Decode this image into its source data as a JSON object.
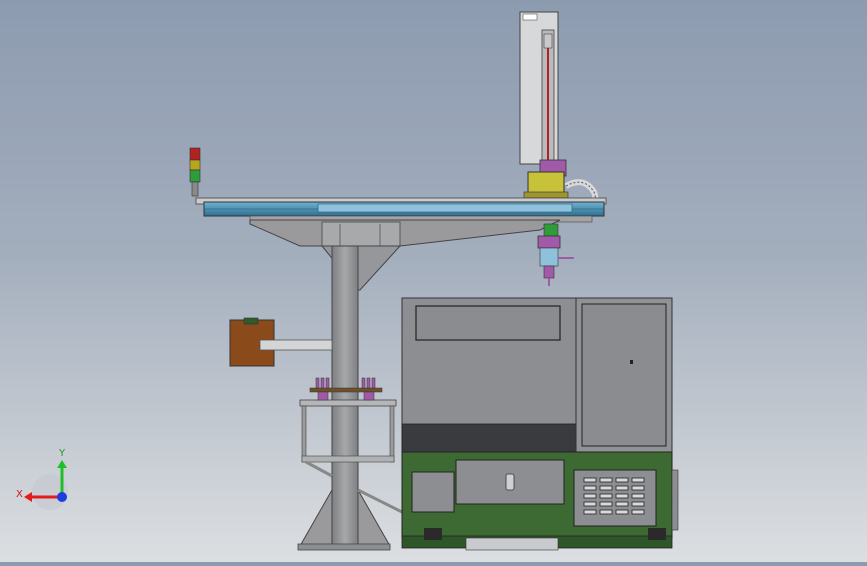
{
  "viewport": {
    "triad": {
      "x_label": "X",
      "y_label": "Y",
      "x_color": "#e11d1d",
      "y_color": "#1fbf2a",
      "z_color": "#1d3ce1"
    }
  },
  "colors": {
    "frame_gray": "#9a9a9c",
    "cabinet_gray": "#8c8e92",
    "base_green": "#3c6a32",
    "rail_blue": "#4e93b6",
    "carriage_yellow": "#c8c23a",
    "gripper_purple": "#a05aa8",
    "box_brown": "#8a4a1a"
  },
  "icons": [
    "coordinate-triad-icon",
    "signal-tower-icon"
  ]
}
